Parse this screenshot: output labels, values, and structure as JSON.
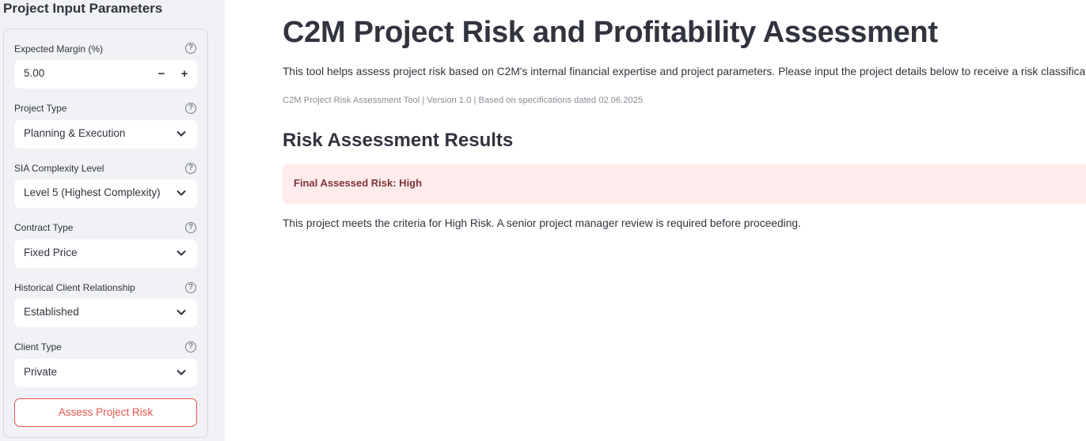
{
  "sidebar": {
    "title": "Project Input Parameters",
    "fields": [
      {
        "label": "Expected Margin (%)",
        "value": "5.00",
        "kind": "number",
        "decrement": "−",
        "increment": "+"
      },
      {
        "label": "Project Type",
        "value": "Planning & Execution",
        "kind": "select"
      },
      {
        "label": "SIA Complexity Level",
        "value": "Level 5 (Highest Complexity)",
        "kind": "select"
      },
      {
        "label": "Contract Type",
        "value": "Fixed Price",
        "kind": "select"
      },
      {
        "label": "Historical Client Relationship",
        "value": "Established",
        "kind": "select"
      },
      {
        "label": "Client Type",
        "value": "Private",
        "kind": "select"
      }
    ],
    "help_glyph": "?",
    "submit_label": "Assess Project Risk"
  },
  "main": {
    "title": "C2M Project Risk and Profitability Assessment",
    "intro": "This tool helps assess project risk based on C2M's internal financial expertise and project parameters. Please input the project details below to receive a risk classification.",
    "caption": "C2M Project Risk Assessment Tool | Version 1.0 | Based on specifications dated 02.06.2025",
    "results_heading": "Risk Assessment Results",
    "alert_text": "Final Assessed Risk: High",
    "result_message": "This project meets the criteria for High Risk. A senior project manager review is required before proceeding."
  },
  "colors": {
    "sidebar_bg": "#f0f2f6",
    "accent": "#e2564e",
    "alert_bg": "#ffebeb",
    "alert_text": "#7d353b",
    "text": "#31333f"
  },
  "icons": {
    "help": "help-circle-icon",
    "dropdown": "chevron-down-icon",
    "minus": "minus-icon",
    "plus": "plus-icon"
  }
}
